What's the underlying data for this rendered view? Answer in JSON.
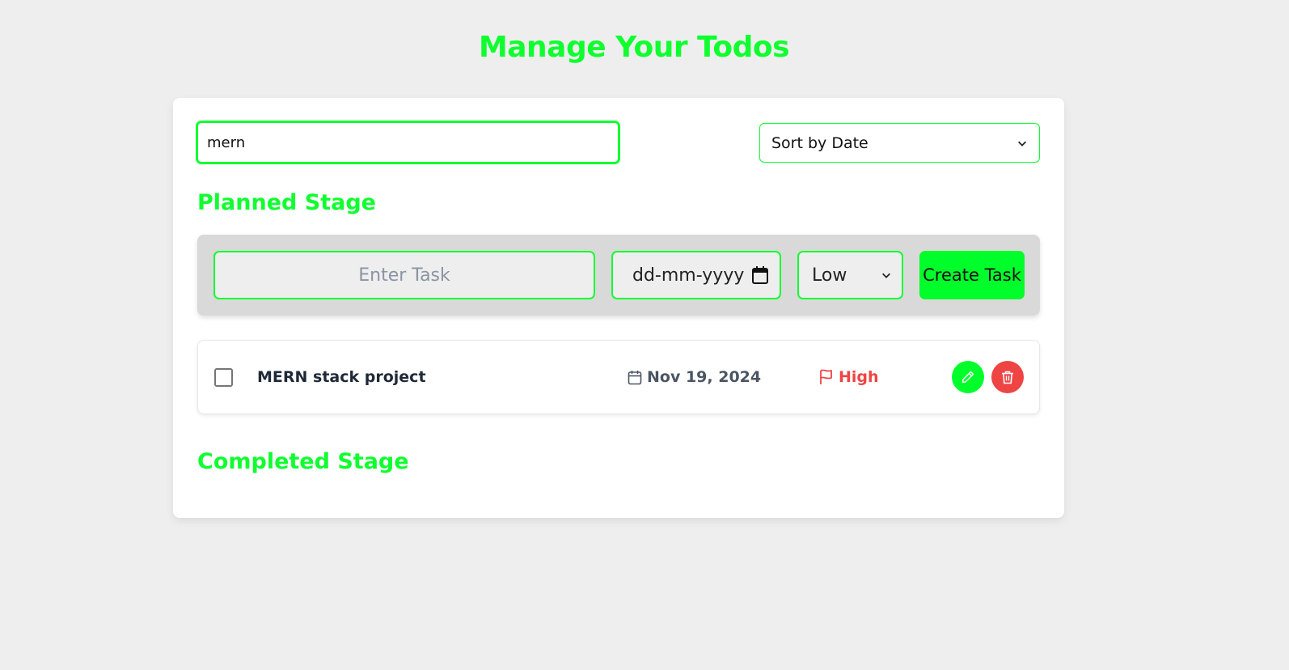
{
  "header": {
    "title": "Manage Your Todos"
  },
  "filters": {
    "search_value": "mern",
    "sort_selected": "Sort by Date"
  },
  "planned": {
    "title": "Planned Stage",
    "form": {
      "task_placeholder": "Enter Task",
      "date_placeholder": "dd-mm-yyyy",
      "priority_selected": "Low",
      "create_label": "Create Task"
    },
    "tasks": [
      {
        "title": "MERN stack project",
        "due_date": "Nov 19, 2024",
        "priority": "High",
        "completed": false
      }
    ]
  },
  "completed": {
    "title": "Completed Stage"
  },
  "colors": {
    "accent": "#0fff2f",
    "priority_high": "#ef4444",
    "delete": "#ef4444"
  },
  "icons": {
    "calendar": "calendar-icon",
    "flag": "flag-icon",
    "edit": "pencil-icon",
    "delete": "trash-icon"
  }
}
